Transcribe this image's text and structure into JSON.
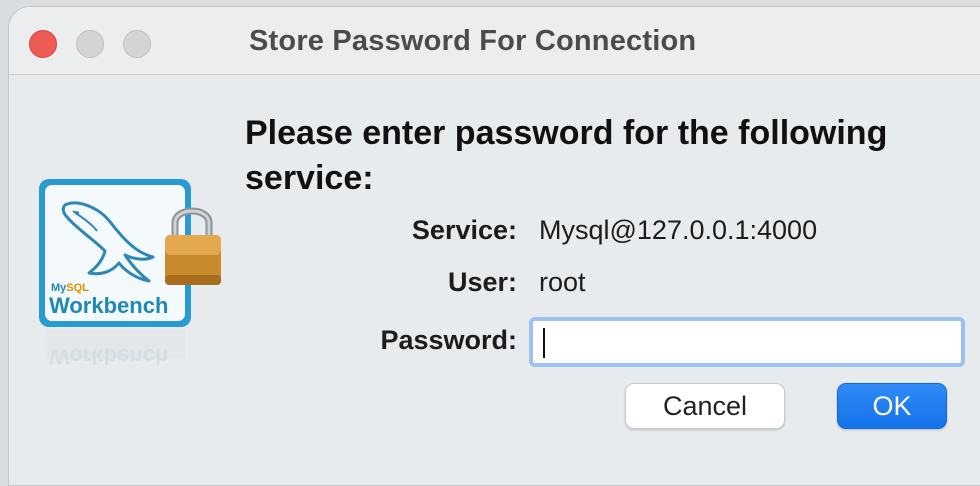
{
  "window": {
    "title": "Store Password For Connection"
  },
  "dialog": {
    "heading": "Please enter password for the following service:",
    "service_label": "Service:",
    "service_value": "Mysql@127.0.0.1:4000",
    "user_label": "User:",
    "user_value": "root",
    "password_label": "Password:",
    "password_value": "",
    "password_placeholder": ""
  },
  "buttons": {
    "cancel_label": "Cancel",
    "ok_label": "OK"
  },
  "icon": {
    "name": "mysql-workbench-lock-icon",
    "brand_small": "MySQL",
    "brand_text": "Workbench",
    "brand_color": "#1f88b4"
  },
  "colors": {
    "close": "#ee5b55",
    "accent": "#1a7af0",
    "focus_ring": "#9cc1f2"
  }
}
